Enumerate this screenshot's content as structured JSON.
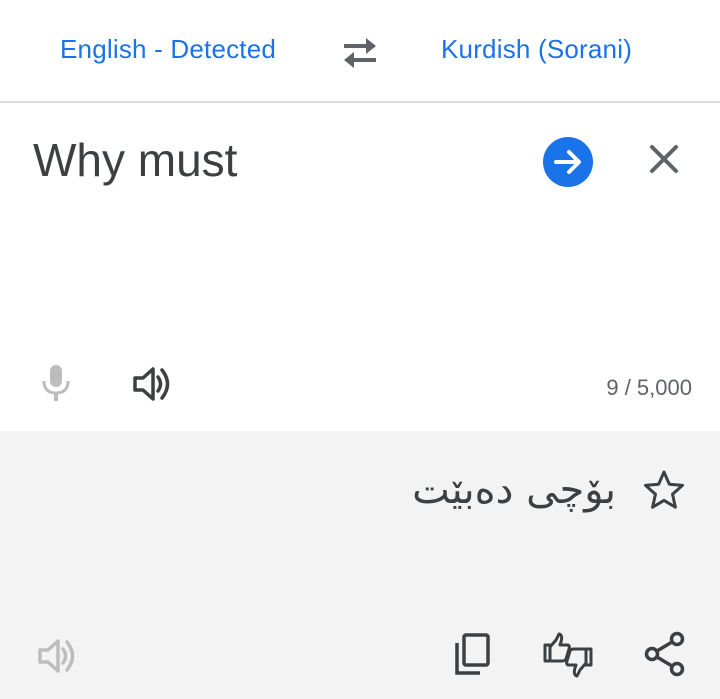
{
  "languages": {
    "source": "English - Detected",
    "target": "Kurdish (Sorani)"
  },
  "input": {
    "text": "Why must",
    "char_count": "9 / 5,000"
  },
  "output": {
    "text": "بۆچی دەبێت"
  },
  "icons": {
    "swap": "swap-arrows-icon",
    "go": "arrow-right-icon",
    "clear": "close-icon",
    "mic": "microphone-icon",
    "speaker": "speaker-icon",
    "star": "star-outline-icon",
    "copy": "copy-icon",
    "feedback": "thumbs-feedback-icon",
    "share": "share-icon"
  },
  "colors": {
    "accent": "#1a73e8",
    "text": "#3c4043",
    "muted": "#5f6368",
    "disabled": "#bdbdbd",
    "output_bg": "#f3f3f3"
  }
}
